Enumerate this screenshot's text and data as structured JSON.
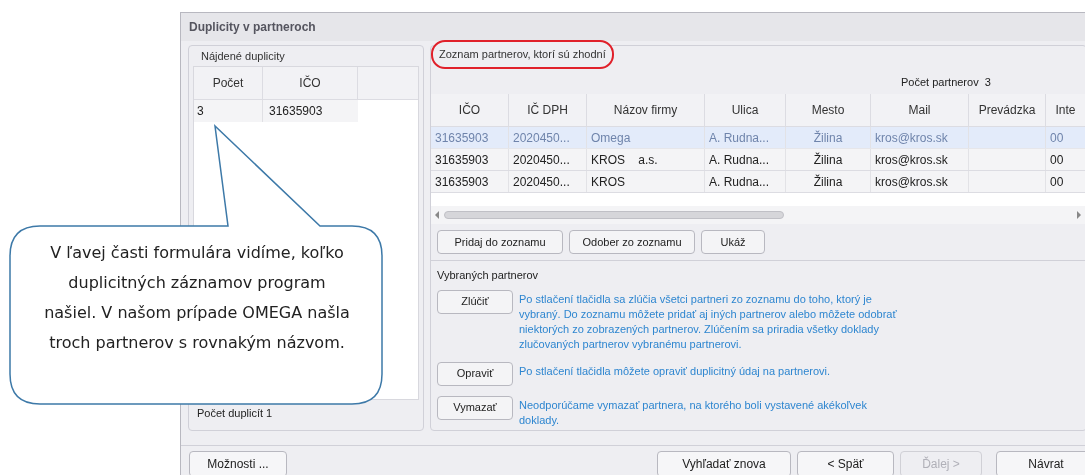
{
  "window": {
    "title": "Duplicity v partneroch"
  },
  "found": {
    "group_label": "Nájdené duplicity",
    "columns": [
      "Počet",
      "IČO"
    ],
    "rows": [
      {
        "cells": [
          "3",
          "31635903"
        ],
        "selected": false
      }
    ],
    "count_label": "Počet duplicít",
    "count": "1"
  },
  "partners": {
    "group_label": "Zoznam partnerov, ktorí sú zhodní",
    "highlighted": true,
    "count_label": "Počet partnerov",
    "count": "3",
    "columns": [
      "IČO",
      "IČ DPH",
      "Názov firmy",
      "Ulica",
      "Mesto",
      "Mail",
      "Prevádzka",
      "Inte"
    ],
    "rows": [
      {
        "cells": [
          "31635903",
          "2020450...",
          "Omega",
          "A. Rudna...",
          "Žilina",
          "kros@kros.sk",
          "",
          "00"
        ],
        "selected": true
      },
      {
        "cells": [
          "31635903",
          "2020450...",
          "KROS    a.s.",
          "A. Rudna...",
          "Žilina",
          "kros@kros.sk",
          "",
          "00"
        ],
        "selected": false
      },
      {
        "cells": [
          "31635903",
          "2020450...",
          "KROS",
          "A. Rudna...",
          "Žilina",
          "kros@kros.sk",
          "",
          "00"
        ],
        "selected": false
      }
    ],
    "buttons": [
      "Pridaj do zoznamu",
      "Odober zo zoznamu",
      "Ukáž"
    ]
  },
  "selected_partners": {
    "label": "Vybraných partnerov",
    "actions": [
      {
        "button": "Zlúčiť",
        "description": "Po stlačení tlačidla sa zlúčia všetci partneri zo zoznamu do toho, ktorý je vybraný. Do zoznamu môžete pridať aj iných partnerov alebo môžete odobrať niektorých zo zobrazených partnerov. Zlúčením sa priradia všetky doklady zlučovaných partnerov vybranému partnerovi."
      },
      {
        "button": "Opraviť",
        "description": "Po stlačení tlačidla môžete opraviť duplicitný údaj na partnerovi."
      },
      {
        "button": "Vymazať",
        "description": "Neodporúčame vymazať partnera, na ktorého boli vystavené akékoľvek doklady."
      }
    ]
  },
  "footer": {
    "left_button": {
      "label": "Možnosti ...",
      "disabled": false
    },
    "buttons": [
      {
        "label": "Vyhľadať znova",
        "disabled": false
      },
      {
        "label": "< Späť",
        "disabled": false
      },
      {
        "label": "Ďalej >",
        "disabled": true
      },
      {
        "label": "Návrat",
        "disabled": false
      }
    ]
  },
  "callout": {
    "text": "V ľavej časti formulára vidíme, koľko duplicitných záznamov program našiel. V našom prípade OMEGA našla troch partnerov s rovnakým názvom."
  }
}
